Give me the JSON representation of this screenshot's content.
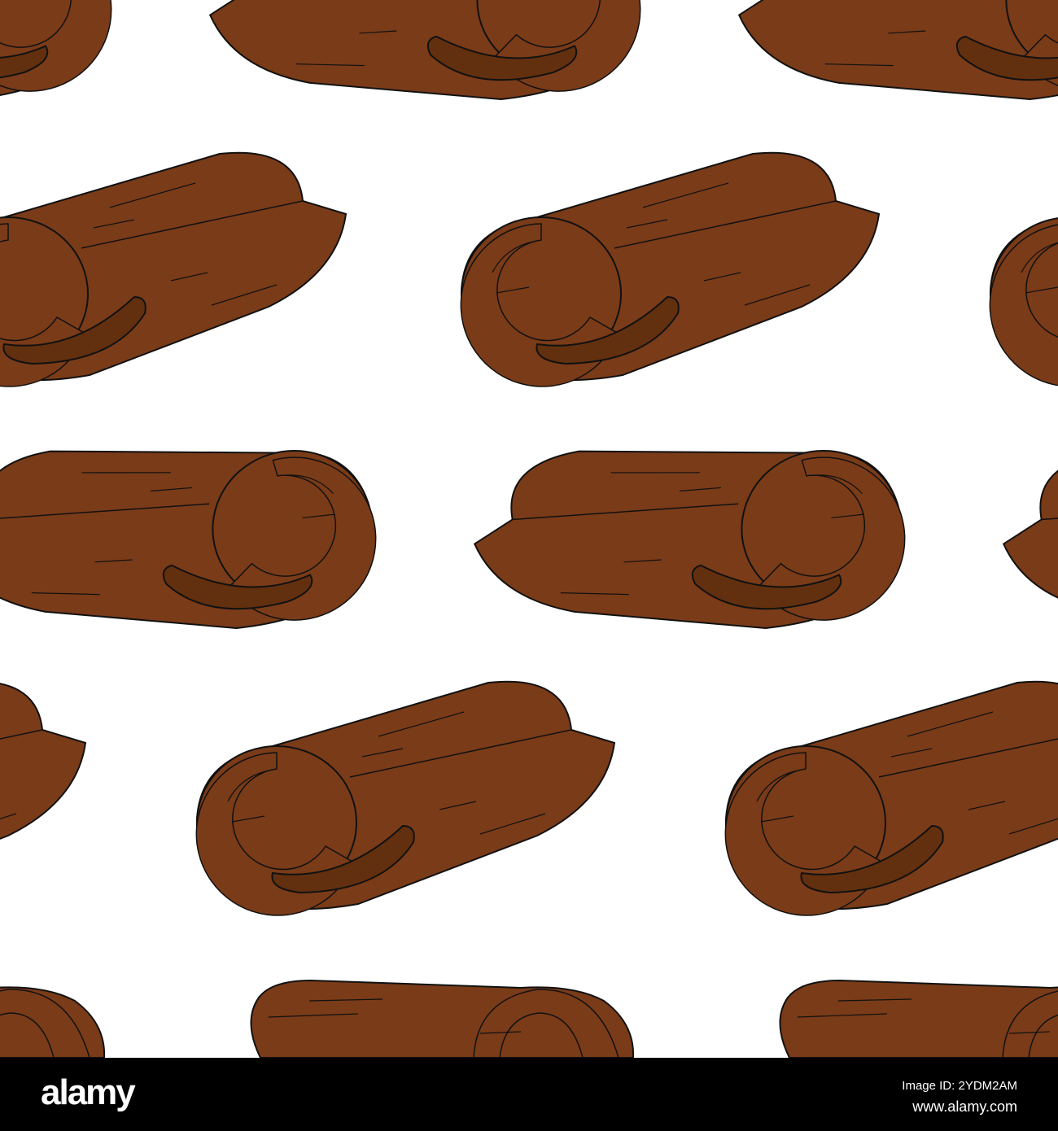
{
  "colors": {
    "background": "#ffffff",
    "bark": "#7a3b18",
    "bark_dark": "#62300f",
    "outline": "#111111",
    "bar": "#000000"
  },
  "footer": {
    "logo": "alamy",
    "image_id": "Image ID: 2YDM2AM",
    "url": "www.alamy.com"
  }
}
